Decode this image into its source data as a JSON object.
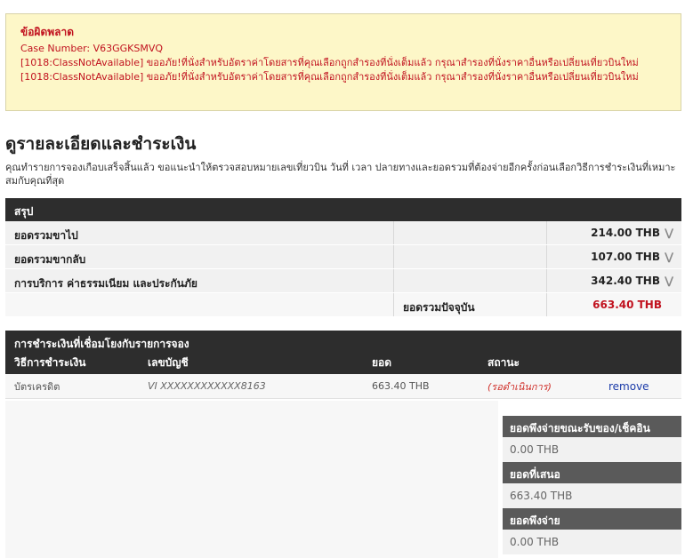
{
  "error": {
    "title": "ข้อผิดพลาด",
    "case_number": "Case Number: V63GGKSMVQ",
    "messages": [
      "[1018:ClassNotAvailable] ขออภัย!ที่นั่งสำหรับอัตราค่าโดยสารที่คุณเลือกถูกสำรองที่นั่งเต็มแล้ว กรุณาสำรองที่นั่งราคาอื่นหรือเปลี่ยนเที่ยวบินใหม่",
      "[1018:ClassNotAvailable] ขออภัย!ที่นั่งสำหรับอัตราค่าโดยสารที่คุณเลือกถูกสำรองที่นั่งเต็มแล้ว กรุณาสำรองที่นั่งราคาอื่นหรือเปลี่ยนเที่ยวบินใหม่"
    ]
  },
  "page": {
    "title": "ดูรายละเอียดและชำระเงิน",
    "intro": "คุณทำรายการจองเกือบเสร็จสิ้นแล้ว ขอแนะนำให้ตรวจสอบหมายเลขเที่ยวบิน วันที่ เวลา ปลายทางและยอดรวมที่ต้องจ่ายอีกครั้งก่อนเลือกวิธีการชำระเงินที่เหมาะสมกับคุณที่สุด"
  },
  "summary": {
    "header": "สรุป",
    "rows": [
      {
        "label": "ยอดรวมขาไป",
        "amount": "214.00 THB"
      },
      {
        "label": "ยอดรวมขากลับ",
        "amount": "107.00 THB"
      },
      {
        "label": "การบริการ ค่าธรรมเนียม และประกันภัย",
        "amount": "342.40 THB"
      }
    ],
    "total_label": "ยอดรวมปัจจุบัน",
    "total_amount": "663.40 THB"
  },
  "linked_payments": {
    "header": "การชำระเงินที่เชื่อมโยงกับรายการจอง",
    "columns": {
      "method": "วิธีการชำระเงิน",
      "account": "เลขบัญชี",
      "amount": "ยอด",
      "status": "สถานะ"
    },
    "rows": [
      {
        "method": "บัตรเครดิต",
        "account": "VI  XXXXXXXXXXXX8163",
        "amount": "663.40 THB",
        "status": "(รอดำเนินการ)",
        "action": "remove"
      }
    ]
  },
  "balances": {
    "due_at_checkin_label": "ยอดพึงจ่ายขณะรับของ/เช็คอิน",
    "due_at_checkin_value": "0.00 THB",
    "offered_label": "ยอดที่เสนอ",
    "offered_value": "663.40 THB",
    "payable_label": "ยอดพึงจ่าย",
    "payable_value": "0.00 THB"
  },
  "colors": {
    "error_text": "#c1121f",
    "header_bg": "#2d2d2d",
    "link": "#1a3aa8"
  },
  "icons": {
    "expand": "chevron-double-down-icon"
  }
}
